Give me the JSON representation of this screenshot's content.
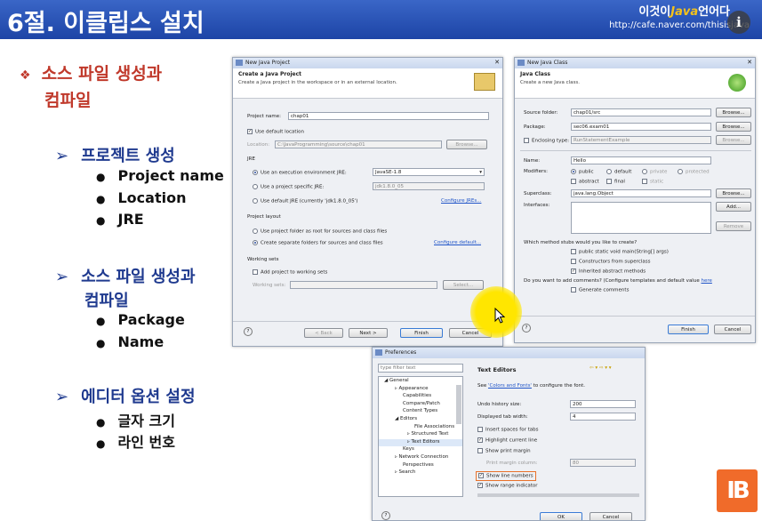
{
  "slide": {
    "title": "6절. 이클립스 설치",
    "brand_prefix": "이것이",
    "brand_java": "Java",
    "brand_suffix": "언어다",
    "url": "http://cafe.naver.com/thisisjava",
    "info_icon": "i"
  },
  "outline": {
    "main_marker": "❖",
    "main_line1": "소스 파일 생성과",
    "main_line2": "컴파일",
    "sub_marker": "➢",
    "bullet": "●",
    "sections": [
      {
        "title": "프로젝트 생성",
        "items": [
          "Project name",
          "Location",
          "JRE"
        ]
      },
      {
        "title_line1": "소스 파일 생성과",
        "title_line2": "컴파일",
        "items": [
          "Package",
          "Name"
        ]
      },
      {
        "title": "에디터 옵션 설정",
        "items": [
          "글자 크기",
          "라인 번호"
        ]
      }
    ]
  },
  "new_project": {
    "window_title": "New Java Project",
    "header_title": "Create a Java Project",
    "header_desc": "Create a Java project in the workspace or in an external location.",
    "project_name_label": "Project name:",
    "project_name_value": "chap01",
    "use_default_location": "Use default location",
    "location_label": "Location:",
    "location_value": "C:\\JavaProgramming\\source\\chap01",
    "browse": "Browse...",
    "jre_group": "JRE",
    "jre_exec_env": "Use an execution environment JRE:",
    "jre_exec_env_value": "JavaSE-1.8",
    "jre_specific": "Use a project specific JRE:",
    "jre_specific_value": "jdk1.8.0_05",
    "jre_default": "Use default JRE (currently 'jdk1.8.0_05')",
    "configure_jres": "Configure JREs...",
    "layout_group": "Project layout",
    "layout_root": "Use project folder as root for sources and class files",
    "layout_separate": "Create separate folders for sources and class files",
    "configure_default": "Configure default...",
    "working_sets_group": "Working sets",
    "add_to_working_sets": "Add project to working sets",
    "working_sets_label": "Working sets:",
    "select": "Select...",
    "help": "?",
    "back": "< Back",
    "next": "Next >",
    "finish": "Finish",
    "cancel": "Cancel"
  },
  "new_class": {
    "window_title": "New Java Class",
    "header_title": "Java Class",
    "header_desc": "Create a new Java class.",
    "source_folder_label": "Source folder:",
    "source_folder_value": "chap01/src",
    "package_label": "Package:",
    "package_value": "sec06.exam01",
    "enclosing_label": "Enclosing type:",
    "enclosing_value": "RunStatementExample",
    "name_label": "Name:",
    "name_value": "Hello",
    "modifiers_label": "Modifiers:",
    "mod_public": "public",
    "mod_default": "default",
    "mod_private": "private",
    "mod_protected": "protected",
    "mod_abstract": "abstract",
    "mod_final": "final",
    "mod_static": "static",
    "superclass_label": "Superclass:",
    "superclass_value": "java.lang.Object",
    "interfaces_label": "Interfaces:",
    "browse": "Browse...",
    "add": "Add...",
    "remove": "Remove",
    "stubs_question": "Which method stubs would you like to create?",
    "stub_main": "public static void main(String[] args)",
    "stub_constructors": "Constructors from superclass",
    "stub_inherited": "Inherited abstract methods",
    "comments_question": "Do you want to add comments? (Configure templates and default value",
    "comments_here": "here",
    "generate_comments": "Generate comments",
    "help": "?",
    "finish": "Finish",
    "cancel": "Cancel"
  },
  "preferences": {
    "window_title": "Preferences",
    "filter_placeholder": "type filter text",
    "tree": [
      "General",
      "Appearance",
      "Capabilities",
      "Compare/Patch",
      "Content Types",
      "Editors",
      "File Associations",
      "Structured Text",
      "Text Editors",
      "Keys",
      "Network Connection",
      "Perspectives",
      "Search"
    ],
    "page_title": "Text Editors",
    "see_prefix": "See",
    "colors_fonts_link": "'Colors and Fonts'",
    "see_suffix": "to configure the font.",
    "undo_label": "Undo history size:",
    "undo_value": "200",
    "tab_width_label": "Displayed tab width:",
    "tab_width_value": "4",
    "insert_spaces": "Insert spaces for tabs",
    "highlight_line": "Highlight current line",
    "show_print_margin": "Show print margin",
    "print_margin_column": "Print margin column:",
    "print_margin_value": "80",
    "show_line_numbers": "Show line numbers",
    "show_range_indicator": "Show range indicator",
    "help": "?",
    "ok": "OK",
    "cancel": "Cancel"
  },
  "logo": {
    "text": "IB"
  },
  "colors": {
    "title_bar": "#2a55b8",
    "red_heading": "#c0392b",
    "blue_heading": "#1f3a8f",
    "highlight": "#ffe600",
    "logo": "#f06b2a"
  }
}
